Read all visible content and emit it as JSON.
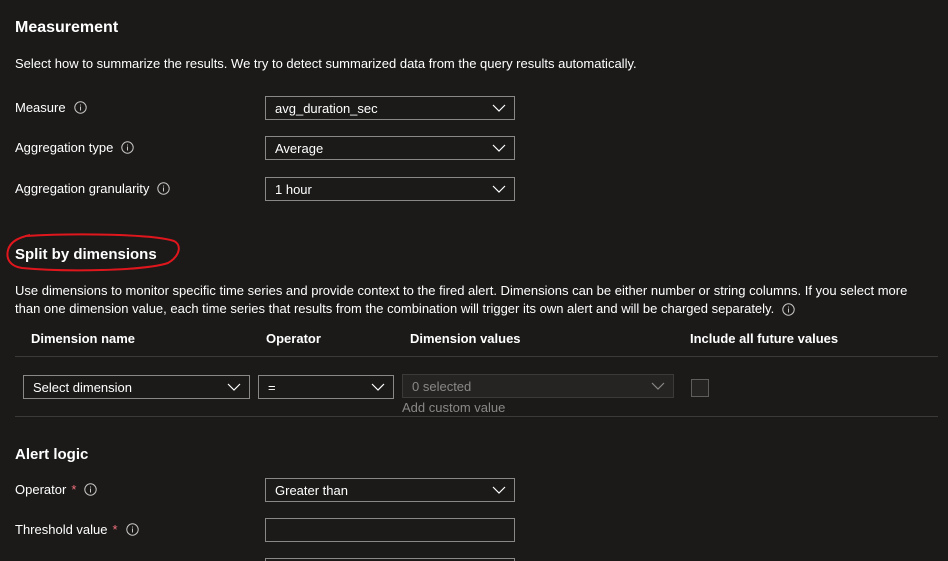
{
  "measurement": {
    "title": "Measurement",
    "description": "Select how to summarize the results. We try to detect summarized data from the query results automatically.",
    "measure": {
      "label": "Measure",
      "value": "avg_duration_sec"
    },
    "aggregation_type": {
      "label": "Aggregation type",
      "value": "Average"
    },
    "aggregation_granularity": {
      "label": "Aggregation granularity",
      "value": "1 hour"
    }
  },
  "split": {
    "title": "Split by dimensions",
    "annotation_color": "#e0161d",
    "description_line1": "Use dimensions to monitor specific time series and provide context to the fired alert. Dimensions can be either number or string columns. If you select more",
    "description_line2": "than one dimension value, each time series that results from the combination will trigger its own alert and will be charged separately.",
    "columns": {
      "dimension_name": "Dimension name",
      "operator": "Operator",
      "dimension_values": "Dimension values",
      "include_future": "Include all future values"
    },
    "row": {
      "dimension_placeholder": "Select dimension",
      "operator_value": "=",
      "values_placeholder": "0 selected",
      "add_custom": "Add custom value"
    }
  },
  "alert_logic": {
    "title": "Alert logic",
    "operator": {
      "label": "Operator",
      "required_mark": "*",
      "value": "Greater than"
    },
    "threshold": {
      "label": "Threshold value",
      "required_mark": "*",
      "value": ""
    }
  },
  "icons": {
    "info": "info-icon",
    "chevron": "chevron-down-icon"
  },
  "colors": {
    "background": "#1b1a19",
    "required": "#f1707b",
    "border": "#8a8886"
  }
}
